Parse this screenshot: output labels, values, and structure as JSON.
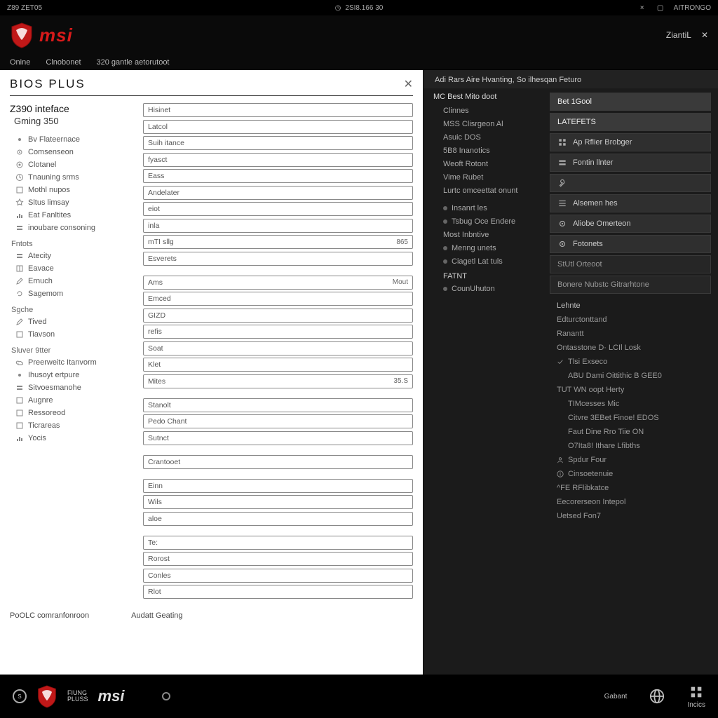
{
  "topbar": {
    "left": "Z89 ZET05",
    "center_icon": "clock",
    "center_text": "2SI8.166 30",
    "close": "×",
    "box": "▢",
    "right_label": "AITRONGO"
  },
  "header": {
    "brand": "msi",
    "right_label": "ZiantiL",
    "right_close": "✕"
  },
  "navtabs": [
    "Onine",
    "Clnobonet",
    "320 gantle aetorutoot"
  ],
  "panel": {
    "title": "BIOS PLUS",
    "heading1": "Z390 inteface",
    "heading2": "Gming 350",
    "sidebar_groups": [
      {
        "items": [
          {
            "icon": "dot",
            "label": "Bv  Flateernace"
          },
          {
            "icon": "gear",
            "label": "Comsenseon"
          },
          {
            "icon": "target",
            "label": "Clotanel"
          },
          {
            "icon": "clock",
            "label": "Tnauning srms"
          }
        ]
      },
      {
        "items": [
          {
            "icon": "square",
            "label": "Mothl nupos"
          },
          {
            "icon": "star",
            "label": "Sltus limsay"
          },
          {
            "icon": "bar",
            "label": "Eat Fanltites"
          },
          {
            "icon": "rows",
            "label": "inoubare consoning"
          }
        ]
      },
      {
        "head": "Fntots",
        "items": [
          {
            "icon": "rows",
            "label": "Atecity"
          },
          {
            "icon": "book",
            "label": "Eavace"
          },
          {
            "icon": "pencil",
            "label": "Ernuch"
          },
          {
            "icon": "loop",
            "label": "Sagemom"
          }
        ]
      },
      {
        "head": "Sgche",
        "items": [
          {
            "icon": "pencil",
            "label": "Tived"
          },
          {
            "icon": "square",
            "label": "Tiavson"
          }
        ]
      },
      {
        "head": "Sluver 9tter",
        "items": [
          {
            "icon": "cloud",
            "label": "Preerweitc Itanvorm"
          },
          {
            "icon": "dot",
            "label": "Ihusoyt ertpure"
          },
          {
            "icon": "rows",
            "label": "Sitvoesmanohe"
          },
          {
            "icon": "square",
            "label": "Augnre"
          },
          {
            "icon": "square",
            "label": "Ressoreod"
          },
          {
            "icon": "square",
            "label": "Ticrareas"
          },
          {
            "icon": "bar",
            "label": "Yocis"
          }
        ]
      }
    ],
    "fields": [
      {
        "label": "Hisinet"
      },
      {
        "label": "Latcol"
      },
      {
        "label": "Suih itance"
      },
      {
        "label": "fyasct"
      },
      {
        "label": "Eass"
      },
      {
        "label": "Andelater"
      },
      {
        "label": "eiot"
      },
      {
        "label": "inla"
      },
      {
        "label": "mTI sllg",
        "rval": "865"
      },
      {
        "label": "Esverets"
      },
      {
        "label": "Ams",
        "rval": "Mout"
      },
      {
        "label": "Emced"
      },
      {
        "label": "GIZD"
      },
      {
        "label": "refis"
      },
      {
        "label": "Soat"
      },
      {
        "label": "Klet"
      },
      {
        "label": "Mites",
        "rval": "35.S"
      },
      {
        "label": "Stanolt"
      },
      {
        "label": "Pedo Chant"
      },
      {
        "label": "Sutnct"
      },
      {
        "label": "Crantooet"
      },
      {
        "label": "Einn"
      },
      {
        "label": "Wils"
      },
      {
        "label": "aloe"
      },
      {
        "label": "Te:"
      },
      {
        "label": "Rorost"
      },
      {
        "label": "Conles"
      },
      {
        "label": "Rlot"
      }
    ],
    "footer_left": "PoOLC comranfonroon",
    "footer_right": "Audatt Geating"
  },
  "right_panel": {
    "headerline": "Adi Rars Aire Hvanting, So ilhesqan Feturo",
    "col1": {
      "title": "MC Best Mito doot",
      "items1": [
        "Clinnes",
        "MSS Clisrgeon Al",
        "Asuic DOS",
        "5B8 Inanotics",
        "Weoft Rotont",
        "Vime Rubet",
        "Lurtc omceettat onunt"
      ],
      "items2": [
        {
          "icon": "dot",
          "label": "Insanrt les"
        },
        {
          "icon": "dot",
          "label": "Tsbug Oce Endere"
        },
        {
          "icon": "",
          "label": "Most Inbntive"
        },
        {
          "icon": "star",
          "label": "Menng unets"
        },
        {
          "icon": "square",
          "label": "Ciagetl Lat tuls"
        }
      ],
      "group_label": "FATNT",
      "items3": [
        {
          "icon": "dot",
          "label": "CounUhuton"
        }
      ]
    },
    "col2": {
      "rows": [
        {
          "type": "header",
          "label": "Bet 1Gool"
        },
        {
          "type": "header",
          "label": "LATEFETS"
        },
        {
          "type": "btn",
          "icon": "grid",
          "label": "Ap Rflier Brobger"
        },
        {
          "type": "btn",
          "icon": "rows",
          "label": "Fontin llnter"
        },
        {
          "type": "btn",
          "icon": "tool",
          "label": ""
        },
        {
          "type": "btn",
          "icon": "bars",
          "label": "Alsemen hes"
        },
        {
          "type": "btn",
          "icon": "gear",
          "label": "Aliobe Omerteon"
        },
        {
          "type": "btn",
          "icon": "gear",
          "label": "Fotonets"
        },
        {
          "type": "sub",
          "label": "StUtl Orteoot"
        },
        {
          "type": "sub",
          "label": "Bonere Nubstc Gitrarhtone"
        }
      ],
      "sublist_head": "Lehnte",
      "sublist": [
        {
          "icon": "",
          "label": "Edturctonttand"
        },
        {
          "icon": "",
          "label": "Ranantt"
        },
        {
          "icon": "",
          "label": "Ontasstone D· LCIl Losk"
        },
        {
          "icon": "check",
          "label": "Tlsi Exseco"
        },
        {
          "icon": "",
          "label": "ABU Dami Oittithic B GEE0",
          "indent": true
        },
        {
          "icon": "",
          "label": "TUT WN oopt Herty"
        },
        {
          "icon": "",
          "label": "TIMcesses Mic",
          "indent": true
        },
        {
          "icon": "",
          "label": "Citvre 3EBet Finoe! EDOS",
          "indent": true
        },
        {
          "icon": "",
          "label": "Faut Dine Rro Tiie ON",
          "indent": true
        },
        {
          "icon": "",
          "label": "O7Ita8! Ithare Lfibths",
          "indent": true
        },
        {
          "icon": "person",
          "label": "Spdur Four"
        },
        {
          "icon": "info",
          "label": "Cinsoetenuie"
        },
        {
          "icon": "",
          "label": "^FE RFlibkatce"
        },
        {
          "icon": "",
          "label": "Eecorerseon Intepol"
        },
        {
          "icon": "",
          "label": "Uetsed Fon7"
        }
      ]
    }
  },
  "footer": {
    "brand_stack1": "FIUNG",
    "brand_stack2": "PLUSS",
    "brand": "msi",
    "right": [
      {
        "icon": "",
        "label": "Gabant"
      },
      {
        "icon": "globe",
        "label": ""
      },
      {
        "icon": "grid",
        "label": "Incics"
      }
    ]
  }
}
